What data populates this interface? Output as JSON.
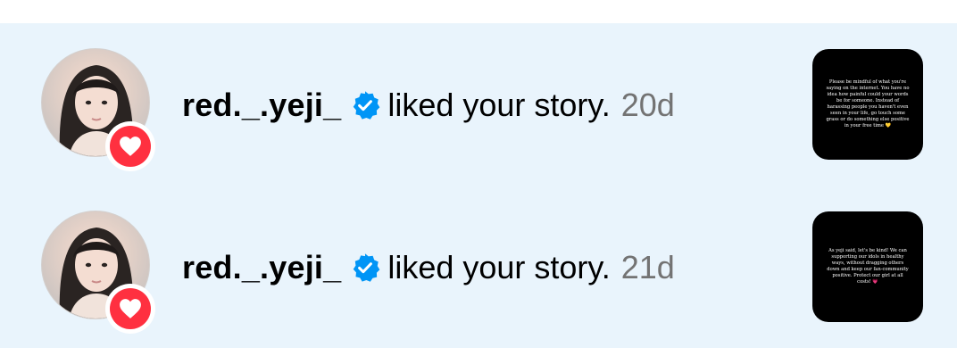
{
  "notifications": [
    {
      "username": "red._.yeji_",
      "action": "liked your story.",
      "time": "20d",
      "story_preview": "Please be mindful of what you're saying on the internet. You have no idea how painful could your words be for someone. Instead of harassing people you haven't even seen in your life, go touch some grass or do something else positive in your free time 💛"
    },
    {
      "username": "red._.yeji_",
      "action": "liked your story.",
      "time": "21d",
      "story_preview": "As yeji said, let's be kind! We can supporting our idols in healthy ways, without dragging others down and keep our fan-community positive. Protect our girl at all costs! 💗"
    }
  ],
  "colors": {
    "list_background": "#e9f4fc",
    "verified_badge": "#0095f6",
    "heart_badge": "#ff3040",
    "timestamp": "#737373"
  },
  "icons": {
    "verified": "verified-badge-icon",
    "heart": "heart-icon"
  }
}
